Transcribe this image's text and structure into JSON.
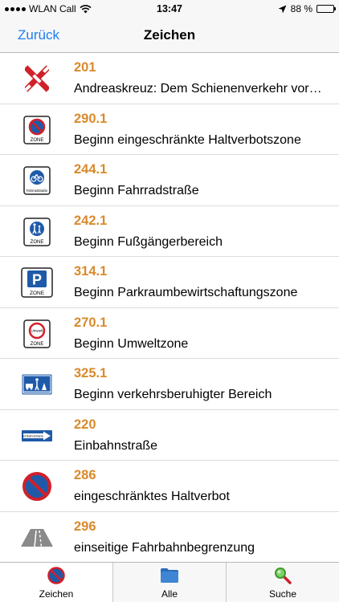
{
  "status_bar": {
    "carrier": "WLAN Call",
    "time": "13:47",
    "battery": "88 %",
    "battery_level": 0.88
  },
  "nav": {
    "back_label": "Zurück",
    "title": "Zeichen"
  },
  "signs": [
    {
      "number": "201",
      "description": "Andreaskreuz: Dem Schienenverkehr vor…",
      "icon": "andreaskreuz-icon"
    },
    {
      "number": "290.1",
      "description": "Beginn eingeschränkte Haltverbotszone",
      "icon": "haltverbotszone-icon"
    },
    {
      "number": "244.1",
      "description": "Beginn Fahrradstraße",
      "icon": "fahrradstrasse-icon"
    },
    {
      "number": "242.1",
      "description": "Beginn Fußgängerbereich",
      "icon": "fussgaengerbereich-icon"
    },
    {
      "number": "314.1",
      "description": "Beginn Parkraumbewirtschaftungszone",
      "icon": "parkzone-icon"
    },
    {
      "number": "270.1",
      "description": "Beginn Umweltzone",
      "icon": "umweltzone-icon"
    },
    {
      "number": "325.1",
      "description": "Beginn verkehrsberuhigter Bereich",
      "icon": "verkehrsberuhigt-icon"
    },
    {
      "number": "220",
      "description": "Einbahnstraße",
      "icon": "einbahnstrasse-icon"
    },
    {
      "number": "286",
      "description": "eingeschränktes Haltverbot",
      "icon": "haltverbot-icon"
    },
    {
      "number": "296",
      "description": "einseitige Fahrbahnbegrenzung",
      "icon": "fahrbahnbegrenzung-icon"
    }
  ],
  "sign_text": {
    "zone": "ZONE",
    "fahrradstrasse": "Fahrradstraße",
    "umwelt": "Umwelt",
    "einbahnstrasse": "Einbahnstraße",
    "parking": "P"
  },
  "tabs": [
    {
      "label": "Zeichen",
      "icon": "no-stopping-icon",
      "active": true
    },
    {
      "label": "Alle",
      "icon": "folder-icon",
      "active": false
    },
    {
      "label": "Suche",
      "icon": "magnifier-icon",
      "active": false
    }
  ],
  "colors": {
    "accent": "#1a7ef0",
    "number": "#d98a2b",
    "sign_red": "#d0202a",
    "sign_blue": "#1f5aa8"
  }
}
